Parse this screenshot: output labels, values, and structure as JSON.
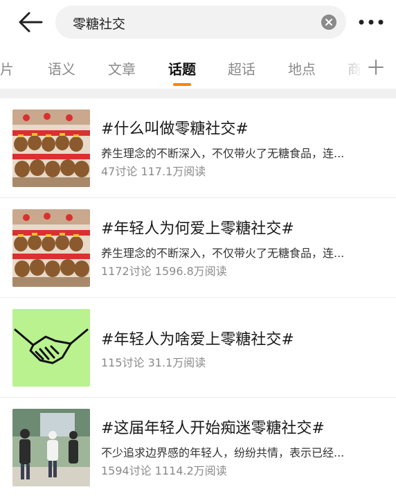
{
  "search": {
    "query": "零糖社交"
  },
  "tabs": [
    {
      "label": "图片",
      "active": false
    },
    {
      "label": "语义",
      "active": false
    },
    {
      "label": "文章",
      "active": false
    },
    {
      "label": "话题",
      "active": true
    },
    {
      "label": "超话",
      "active": false
    },
    {
      "label": "地点",
      "active": false
    },
    {
      "label": "商",
      "active": false
    }
  ],
  "colors": {
    "accent": "#ff8200",
    "muted": "#8a8a8a",
    "thumb_green": "#b9f28f"
  },
  "topics": [
    {
      "title": "#什么叫做零糖社交#",
      "desc": "养生理念的不断深入，不仅带火了无糖食品，连...",
      "stats": "47讨论 117.1万阅读",
      "thumb": "plush-toys-photo"
    },
    {
      "title": "#年轻人为何爱上零糖社交#",
      "desc": "养生理念的不断深入，不仅带火了无糖食品，连...",
      "stats": "1172讨论 1596.8万阅读",
      "thumb": "plush-toys-photo"
    },
    {
      "title": "#年轻人为啥爱上零糖社交#",
      "desc": "",
      "stats": "115讨论 31.1万阅读",
      "thumb": "handshake-icon"
    },
    {
      "title": "#这届年轻人开始痴迷零糖社交#",
      "desc": "不少追求边界感的年轻人，纷纷共情，表示已经...",
      "stats": "1594讨论 1114.2万阅读",
      "thumb": "people-photo"
    }
  ]
}
